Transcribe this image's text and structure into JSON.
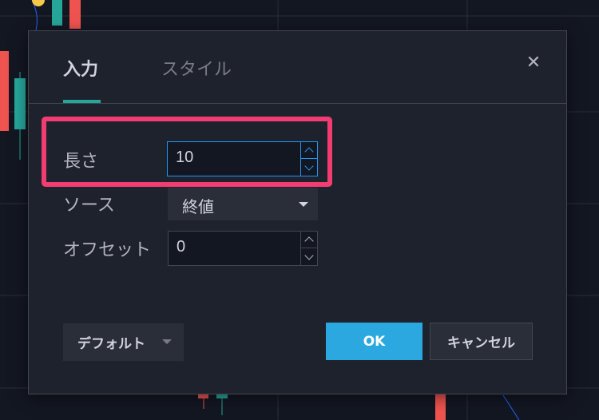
{
  "dialog": {
    "tabs": [
      {
        "label": "入力",
        "active": true
      },
      {
        "label": "スタイル",
        "active": false
      }
    ],
    "close_icon": "close-icon",
    "fields": {
      "length": {
        "label": "長さ",
        "value": "10"
      },
      "source": {
        "label": "ソース",
        "value": "終値"
      },
      "offset": {
        "label": "オフセット",
        "value": "0"
      }
    },
    "buttons": {
      "defaults": "デフォルト",
      "ok": "OK",
      "cancel": "キャンセル"
    }
  },
  "colors": {
    "background": "#131722",
    "dialog": "#1e222d",
    "accent_tab": "#26a69a",
    "ok_button": "#2ba8e0",
    "highlight": "#f23d72",
    "candle_up": "#26a69a",
    "candle_down": "#ef5350",
    "focus_border": "#2196f3"
  }
}
